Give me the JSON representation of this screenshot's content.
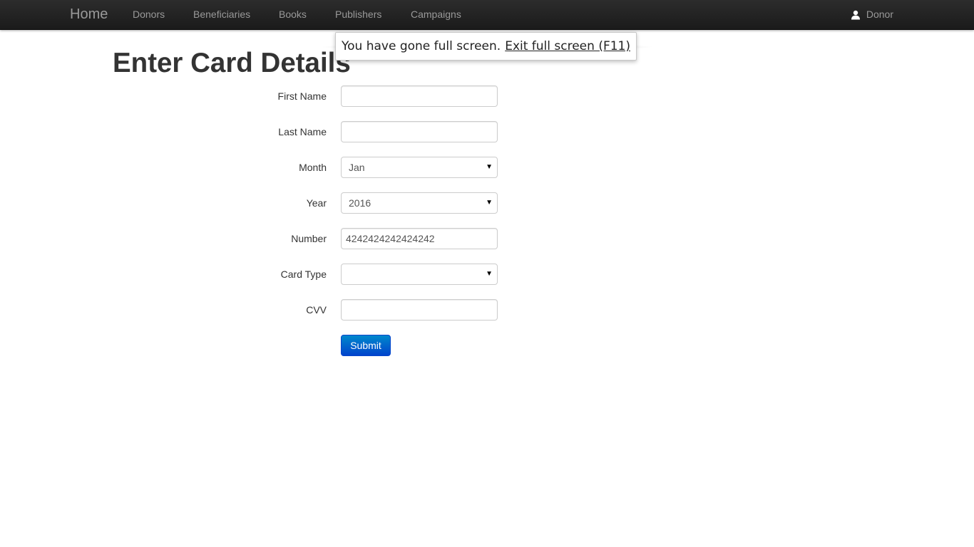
{
  "navbar": {
    "brand": "Home",
    "links": [
      "Donors",
      "Beneficiaries",
      "Books",
      "Publishers",
      "Campaigns"
    ],
    "user_label": "Donor",
    "user_icon": "user-icon"
  },
  "page": {
    "title": "Enter Card Details"
  },
  "form": {
    "first_name": {
      "label": "First Name",
      "value": ""
    },
    "last_name": {
      "label": "Last Name",
      "value": ""
    },
    "month": {
      "label": "Month",
      "value": "Jan"
    },
    "year": {
      "label": "Year",
      "value": "2016"
    },
    "number": {
      "label": "Number",
      "value": "4242424242424242"
    },
    "card_type": {
      "label": "Card Type",
      "value": ""
    },
    "cvv": {
      "label": "CVV",
      "value": ""
    },
    "submit_label": "Submit"
  },
  "fullscreen_notice": {
    "message": "You have gone full screen.",
    "exit_label": "Exit full screen (F11)"
  },
  "colors": {
    "navbar_bg": "#222222",
    "submit_bg": "#0066cc"
  }
}
